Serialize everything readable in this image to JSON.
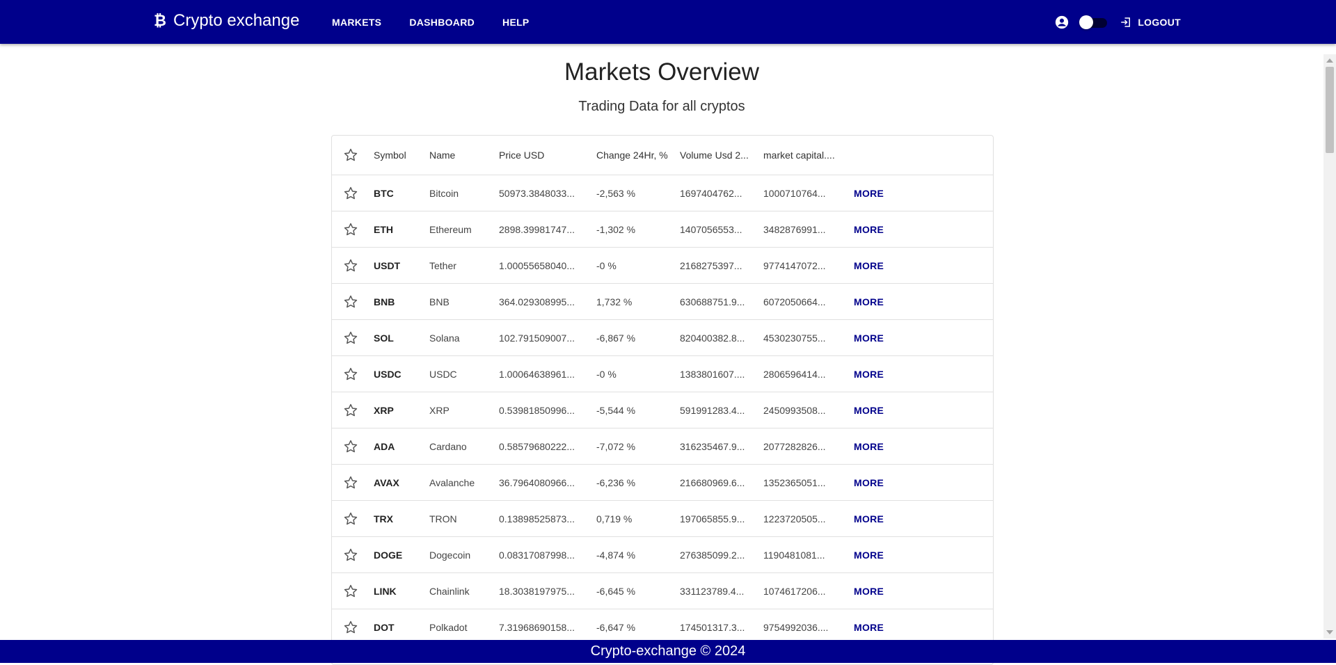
{
  "app": {
    "brand_icon": "bitcoin-icon",
    "brand_title": "Crypto exchange"
  },
  "nav": {
    "markets": "MARKETS",
    "dashboard": "DASHBOARD",
    "help": "HELP"
  },
  "header_tools": {
    "logout": "LOGOUT"
  },
  "page": {
    "title": "Markets Overview",
    "subtitle": "Trading Data for all cryptos"
  },
  "table": {
    "columns": {
      "symbol": "Symbol",
      "name": "Name",
      "price": "Price USD",
      "change": "Change 24Hr, %",
      "volume": "Volume Usd 2...",
      "cap": "market capital...."
    },
    "more_label": "MORE",
    "rows": [
      {
        "symbol": "BTC",
        "name": "Bitcoin",
        "price": "50973.3848033...",
        "change": "-2,563 %",
        "volume": "1697404762...",
        "cap": "1000710764..."
      },
      {
        "symbol": "ETH",
        "name": "Ethereum",
        "price": "2898.39981747...",
        "change": "-1,302 %",
        "volume": "1407056553...",
        "cap": "3482876991..."
      },
      {
        "symbol": "USDT",
        "name": "Tether",
        "price": "1.00055658040...",
        "change": "-0 %",
        "volume": "2168275397...",
        "cap": "9774147072..."
      },
      {
        "symbol": "BNB",
        "name": "BNB",
        "price": "364.029308995...",
        "change": "1,732 %",
        "volume": "630688751.9...",
        "cap": "6072050664..."
      },
      {
        "symbol": "SOL",
        "name": "Solana",
        "price": "102.791509007...",
        "change": "-6,867 %",
        "volume": "820400382.8...",
        "cap": "4530230755..."
      },
      {
        "symbol": "USDC",
        "name": "USDC",
        "price": "1.00064638961...",
        "change": "-0 %",
        "volume": "1383801607....",
        "cap": "2806596414..."
      },
      {
        "symbol": "XRP",
        "name": "XRP",
        "price": "0.53981850996...",
        "change": "-5,544 %",
        "volume": "591991283.4...",
        "cap": "2450993508..."
      },
      {
        "symbol": "ADA",
        "name": "Cardano",
        "price": "0.58579680222...",
        "change": "-7,072 %",
        "volume": "316235467.9...",
        "cap": "2077282826..."
      },
      {
        "symbol": "AVAX",
        "name": "Avalanche",
        "price": "36.7964080966...",
        "change": "-6,236 %",
        "volume": "216680969.6...",
        "cap": "1352365051..."
      },
      {
        "symbol": "TRX",
        "name": "TRON",
        "price": "0.13898525873...",
        "change": "0,719 %",
        "volume": "197065855.9...",
        "cap": "1223720505..."
      },
      {
        "symbol": "DOGE",
        "name": "Dogecoin",
        "price": "0.08317087998...",
        "change": "-4,874 %",
        "volume": "276385099.2...",
        "cap": "1190481081..."
      },
      {
        "symbol": "LINK",
        "name": "Chainlink",
        "price": "18.3038197975...",
        "change": "-6,645 %",
        "volume": "331123789.4...",
        "cap": "1074617206..."
      },
      {
        "symbol": "DOT",
        "name": "Polkadot",
        "price": "7.31968690158...",
        "change": "-6,647 %",
        "volume": "174501317.3...",
        "cap": "9754992036...."
      }
    ]
  },
  "footer": {
    "text": "Crypto-exchange © 2024"
  },
  "colors": {
    "primary": "#00008b",
    "more": "#00008b",
    "background": "#ffffff"
  }
}
